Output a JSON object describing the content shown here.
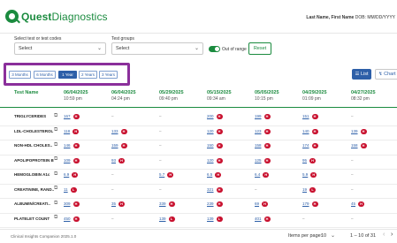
{
  "header": {
    "brand_bold": "Quest",
    "brand_light": "Diagnostics",
    "patient_name": "Last Name, First Name",
    "patient_dob": "DOB: MM/DD/YYYY"
  },
  "filters": {
    "tests_label": "Select test or test codes",
    "tests_value": "Select",
    "groups_label": "Test groups",
    "groups_value": "Select",
    "out_of_range_label": "Out of range",
    "out_of_range_on": true,
    "reset_label": "Reset"
  },
  "ranges": [
    "3 Months",
    "6 Months",
    "1 Year",
    "2 Years",
    "3 Years"
  ],
  "active_range": "1 Year",
  "view": {
    "list_label": "List",
    "chart_label": "Chart",
    "list_icon": "list-icon",
    "chart_icon": "chart-icon"
  },
  "table": {
    "name_header": "Test Name",
    "columns": [
      {
        "date": "06/04/2025",
        "time": "10:59 pm"
      },
      {
        "date": "06/04/2025",
        "time": "04:24 pm"
      },
      {
        "date": "05/29/2025",
        "time": "09:40 pm"
      },
      {
        "date": "05/15/2025",
        "time": "09:34 am"
      },
      {
        "date": "05/05/2025",
        "time": "10:15 pm"
      },
      {
        "date": "04/29/2025",
        "time": "01:09 pm"
      },
      {
        "date": "04/27/2025",
        "time": "08:32 pm"
      }
    ],
    "rows": [
      {
        "name": "TRIGLYCERIDES",
        "cells": [
          {
            "v": "167",
            "f": "H"
          },
          {
            "v": "–"
          },
          {
            "v": "–"
          },
          {
            "v": "200",
            "f": "H"
          },
          {
            "v": "199",
            "f": "H"
          },
          {
            "v": "151",
            "f": "H"
          },
          {
            "v": "–"
          }
        ]
      },
      {
        "name": "LDL-CHOLESTEROL",
        "cells": [
          {
            "v": "118",
            "f": "H"
          },
          {
            "v": "133",
            "f": "H"
          },
          {
            "v": "–"
          },
          {
            "v": "120",
            "f": "H"
          },
          {
            "v": "123",
            "f": "H"
          },
          {
            "v": "140",
            "f": "H"
          },
          {
            "v": "139",
            "f": "H"
          }
        ]
      },
      {
        "name": "NON-HDL CHOLES..",
        "cells": [
          {
            "v": "146",
            "f": "H"
          },
          {
            "v": "159",
            "f": "H"
          },
          {
            "v": "–"
          },
          {
            "v": "150",
            "f": "H"
          },
          {
            "v": "158",
            "f": "H"
          },
          {
            "v": "174",
            "f": "H"
          },
          {
            "v": "158",
            "f": "H"
          }
        ]
      },
      {
        "name": "APOLIPOPROTEIN B",
        "cells": [
          {
            "v": "109",
            "f": "H"
          },
          {
            "v": "93",
            "f": "H"
          },
          {
            "v": "–"
          },
          {
            "v": "120",
            "f": "H"
          },
          {
            "v": "125",
            "f": "H"
          },
          {
            "v": "95",
            "f": "H"
          },
          {
            "v": "–"
          }
        ]
      },
      {
        "name": "HEMOGLOBIN A1c",
        "cells": [
          {
            "v": "6.9",
            "f": "H"
          },
          {
            "v": "–"
          },
          {
            "v": "5.7",
            "f": "H"
          },
          {
            "v": "6.5",
            "f": "H"
          },
          {
            "v": "6.4",
            "f": "H"
          },
          {
            "v": "5.9",
            "f": "H"
          },
          {
            "v": "–"
          }
        ]
      },
      {
        "name": "CREATININE, RAND..",
        "cells": [
          {
            "v": "11",
            "f": "L"
          },
          {
            "v": "–"
          },
          {
            "v": "–"
          },
          {
            "v": "321",
            "f": "H"
          },
          {
            "v": "–"
          },
          {
            "v": "19",
            "f": "L"
          },
          {
            "v": "–"
          }
        ]
      },
      {
        "name": "ALBUMIN/CREATI..",
        "cells": [
          {
            "v": "309",
            "f": "H"
          },
          {
            "v": "35",
            "f": "H"
          },
          {
            "v": "339",
            "f": "H"
          },
          {
            "v": "239",
            "f": "H"
          },
          {
            "v": "69",
            "f": "H"
          },
          {
            "v": "179",
            "f": "H"
          },
          {
            "v": "45",
            "f": "H"
          }
        ]
      },
      {
        "name": "PLATELET COUNT",
        "cells": [
          {
            "v": "450",
            "f": "H"
          },
          {
            "v": "–"
          },
          {
            "v": "139",
            "f": "L"
          },
          {
            "v": "139",
            "f": "L"
          },
          {
            "v": "401",
            "f": "H"
          },
          {
            "v": "–"
          },
          {
            "v": "–"
          }
        ]
      }
    ]
  },
  "footer": {
    "version": "Clinical Insights Companion 2025.1.0",
    "items_per_page_label": "Items per page:",
    "items_per_page_value": "10",
    "range_text": "1 – 10 of 31",
    "prev_icon": "chevron-left-icon",
    "next_icon": "chevron-right-icon"
  },
  "colors": {
    "brand_green": "#1b8b3f",
    "accent_blue": "#2d5fa8",
    "flag_red": "#c8102e",
    "highlight_purple": "#8b2f9b"
  }
}
